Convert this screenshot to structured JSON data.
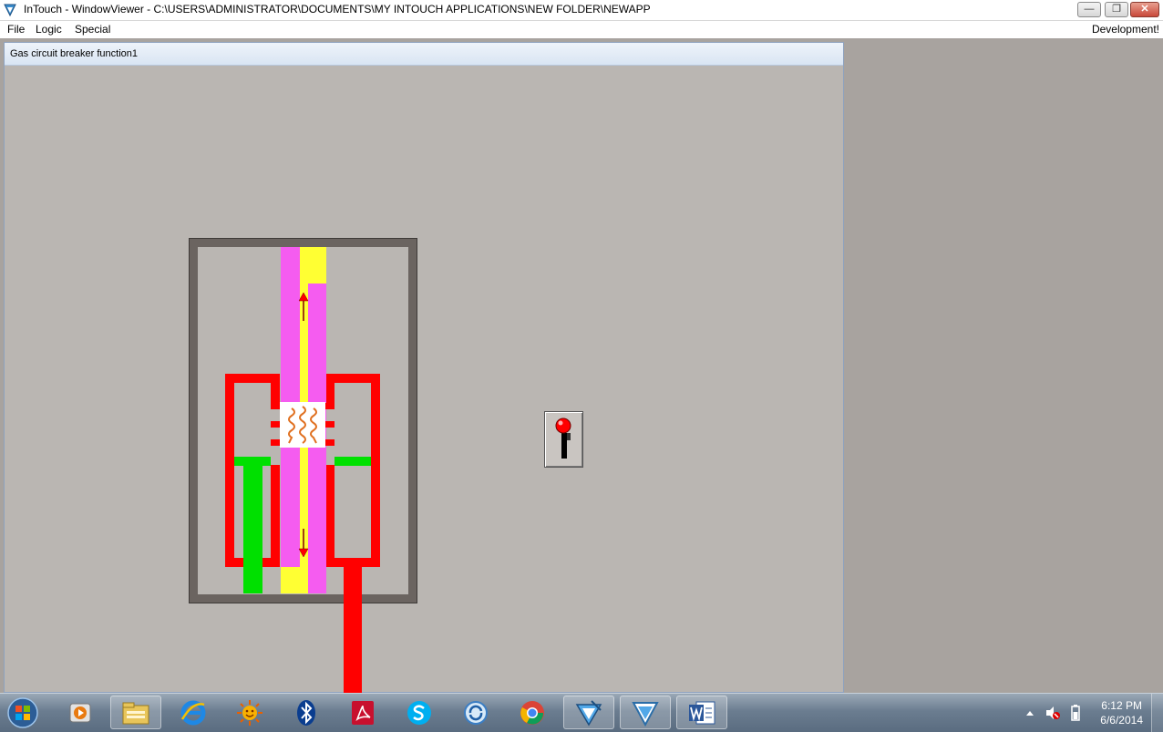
{
  "window": {
    "title": "InTouch - WindowViewer - C:\\USERS\\ADMINISTRATOR\\DOCUMENTS\\MY INTOUCH APPLICATIONS\\NEW FOLDER\\NEWAPP",
    "minimize_label": "—",
    "maximize_label": "❐",
    "close_label": "✕"
  },
  "menu": {
    "items": [
      {
        "label": "File"
      },
      {
        "label": "Logic"
      },
      {
        "label": "Special"
      }
    ],
    "right_label": "Development!"
  },
  "child_window": {
    "title": "Gas circuit breaker function1"
  },
  "colors": {
    "frame": "#6b6460",
    "red": "#ff0000",
    "green": "#00e000",
    "pink": "#f55cf0",
    "yellow": "#ffff33",
    "arc": "#e07020"
  },
  "taskbar": {
    "items": [
      "start-orb-icon",
      "media-player-icon",
      "file-explorer-icon",
      "internet-explorer-icon",
      "sun-app-icon",
      "bluetooth-icon",
      "acrobat-icon",
      "skype-icon",
      "sync-app-icon",
      "chrome-icon",
      "intouch-app-icon",
      "windowviewer-icon",
      "word-icon"
    ],
    "clock_time": "6:12 PM",
    "clock_date": "6/6/2014"
  }
}
